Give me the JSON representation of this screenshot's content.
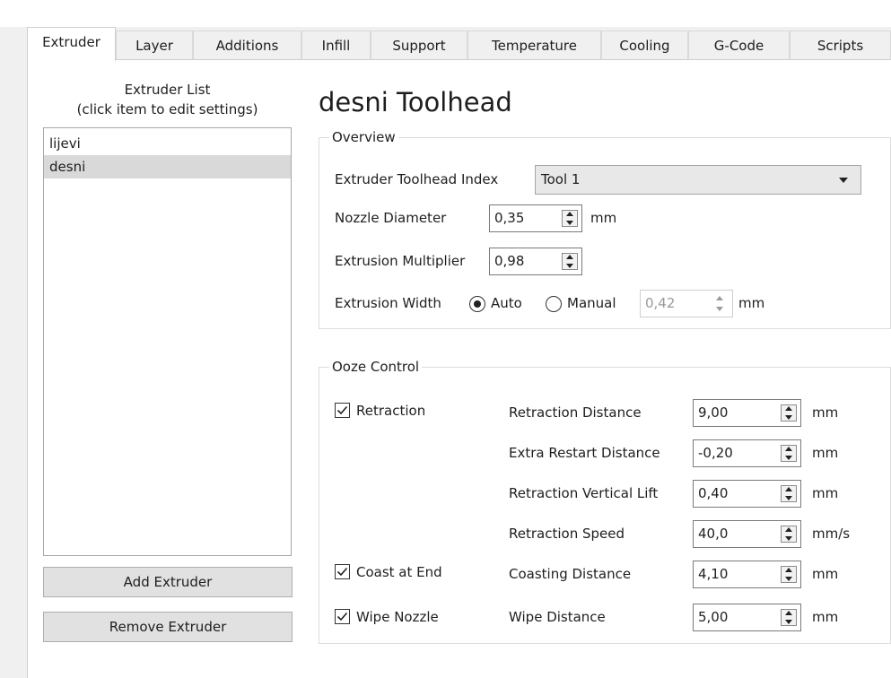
{
  "tabs": [
    {
      "label": "Extruder",
      "active": true
    },
    {
      "label": "Layer"
    },
    {
      "label": "Additions"
    },
    {
      "label": "Infill"
    },
    {
      "label": "Support"
    },
    {
      "label": "Temperature"
    },
    {
      "label": "Cooling"
    },
    {
      "label": "G-Code"
    },
    {
      "label": "Scripts"
    }
  ],
  "extruder_list": {
    "title_line1": "Extruder List",
    "title_line2": "(click item to edit settings)",
    "items": [
      "lijevi",
      "desni"
    ],
    "selected": "desni",
    "add_label": "Add Extruder",
    "remove_label": "Remove Extruder"
  },
  "toolhead_title": "desni Toolhead",
  "overview": {
    "legend": "Overview",
    "index_label": "Extruder Toolhead Index",
    "index_value": "Tool 1",
    "nozzle_label": "Nozzle Diameter",
    "nozzle_value": "0,35",
    "nozzle_unit": "mm",
    "multiplier_label": "Extrusion Multiplier",
    "multiplier_value": "0,98",
    "width_label": "Extrusion Width",
    "width_auto_label": "Auto",
    "width_manual_label": "Manual",
    "width_mode": "Auto",
    "width_value": "0,42",
    "width_unit": "mm"
  },
  "ooze": {
    "legend": "Ooze Control",
    "retraction_label": "Retraction",
    "retraction_checked": true,
    "coast_label": "Coast at End",
    "coast_checked": true,
    "wipe_label": "Wipe Nozzle",
    "wipe_checked": true,
    "rows": [
      {
        "label": "Retraction Distance",
        "value": "9,00",
        "unit": "mm"
      },
      {
        "label": "Extra Restart Distance",
        "value": "-0,20",
        "unit": "mm"
      },
      {
        "label": "Retraction Vertical Lift",
        "value": "0,40",
        "unit": "mm"
      },
      {
        "label": "Retraction Speed",
        "value": "40,0",
        "unit": "mm/s"
      },
      {
        "label": "Coasting Distance",
        "value": "4,10",
        "unit": "mm"
      },
      {
        "label": "Wipe Distance",
        "value": "5,00",
        "unit": "mm"
      }
    ]
  }
}
